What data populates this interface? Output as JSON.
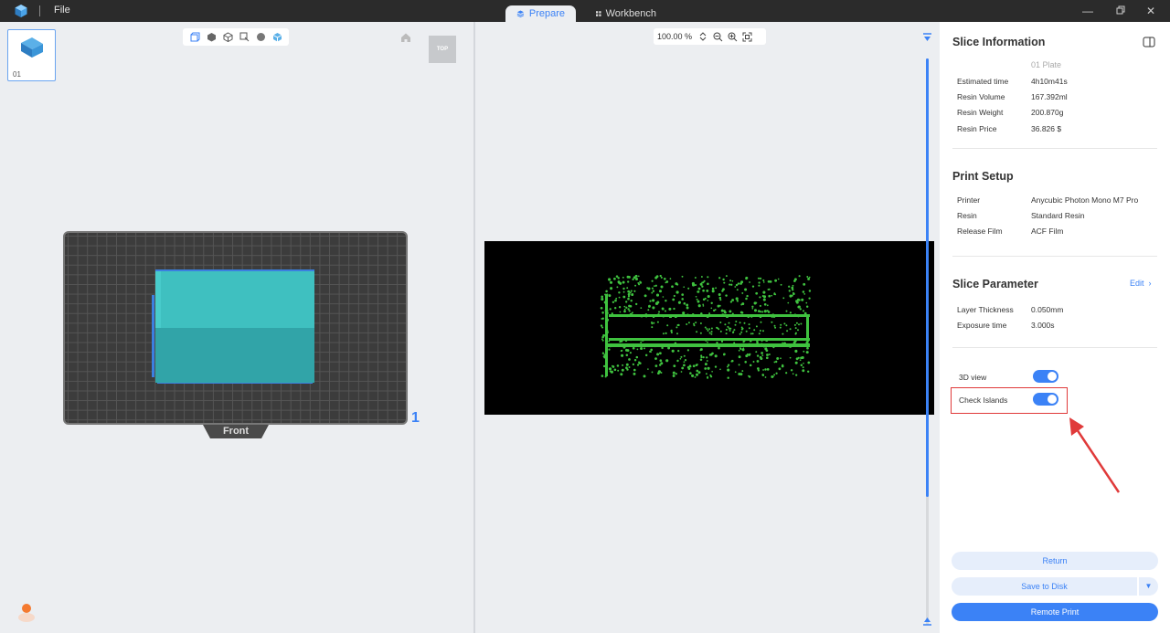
{
  "titlebar": {
    "menu_file": "File",
    "tabs": [
      {
        "label": "Prepare",
        "active": true
      },
      {
        "label": "Workbench",
        "active": false
      }
    ]
  },
  "left_view": {
    "plate_thumb_label": "01",
    "view_cube_label": "TOP",
    "plate_face_label": "Front",
    "plate_number": "1"
  },
  "mid_view": {
    "zoom_value": "100.00 %"
  },
  "slice_info": {
    "title": "Slice Information",
    "plate_name": "01 Plate",
    "rows": [
      {
        "label": "Estimated time",
        "value": "4h10m41s"
      },
      {
        "label": "Resin Volume",
        "value": "167.392ml"
      },
      {
        "label": "Resin Weight",
        "value": "200.870g"
      },
      {
        "label": "Resin Price",
        "value": "36.826 $"
      }
    ]
  },
  "print_setup": {
    "title": "Print Setup",
    "rows": [
      {
        "label": "Printer",
        "value": "Anycubic Photon Mono M7 Pro"
      },
      {
        "label": "Resin",
        "value": "Standard Resin"
      },
      {
        "label": "Release Film",
        "value": "ACF Film"
      }
    ]
  },
  "slice_parameter": {
    "title": "Slice Parameter",
    "edit_label": "Edit",
    "rows": [
      {
        "label": "Layer Thickness",
        "value": "0.050mm"
      },
      {
        "label": "Exposure time",
        "value": "3.000s"
      }
    ]
  },
  "toggles": [
    {
      "label": "3D view",
      "on": true
    },
    {
      "label": "Check Islands",
      "on": true
    }
  ],
  "buttons": {
    "return": "Return",
    "save_to_disk": "Save to Disk",
    "remote_print": "Remote Print"
  },
  "colors": {
    "accent": "#3b82f6",
    "highlight": "#e03a3a",
    "model": "#3dbdbd",
    "island_green": "#3fc23f"
  }
}
